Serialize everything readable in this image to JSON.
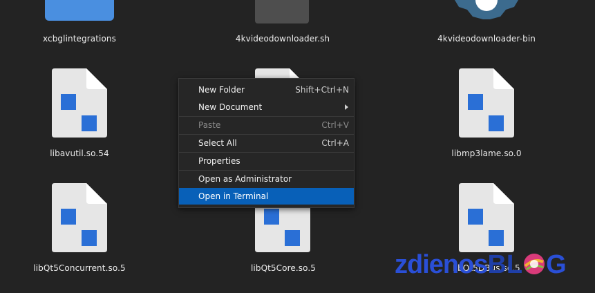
{
  "files": [
    {
      "name": "xcbglintegrations",
      "icon": "folder-icon"
    },
    {
      "name": "4kvideodownloader.sh",
      "icon": "script-icon"
    },
    {
      "name": "4kvideodownloader-bin",
      "icon": "gear-icon"
    },
    {
      "name": "libavutil.so.54",
      "icon": "library-file-icon"
    },
    {
      "name": "libmp3lame.so.0",
      "icon": "library-file-icon"
    },
    {
      "name": "libQt5Concurrent.so.5",
      "icon": "library-file-icon"
    },
    {
      "name": "libQt5Core.so.5",
      "icon": "library-file-icon"
    },
    {
      "name": "libQt5DBus.so.5",
      "icon": "library-file-icon"
    }
  ],
  "context_menu": {
    "items": [
      {
        "label": "New Folder",
        "shortcut": "Shift+Ctrl+N"
      },
      {
        "label": "New Document",
        "submenu": true
      },
      {
        "label": "Paste",
        "shortcut": "Ctrl+V",
        "disabled": true
      },
      {
        "label": "Select All",
        "shortcut": "Ctrl+A"
      },
      {
        "label": "Properties"
      },
      {
        "label": "Open as Administrator"
      },
      {
        "label": "Open in Terminal",
        "highlighted": true
      }
    ]
  },
  "watermark": {
    "text_a": "zdienos",
    "text_b": "BL",
    "text_c": "G"
  },
  "colors": {
    "background": "#232323",
    "highlight": "#0860b8",
    "folder": "#4a8fe0",
    "file_blue": "#2a6fd6",
    "file_page": "#e6e6e6"
  }
}
